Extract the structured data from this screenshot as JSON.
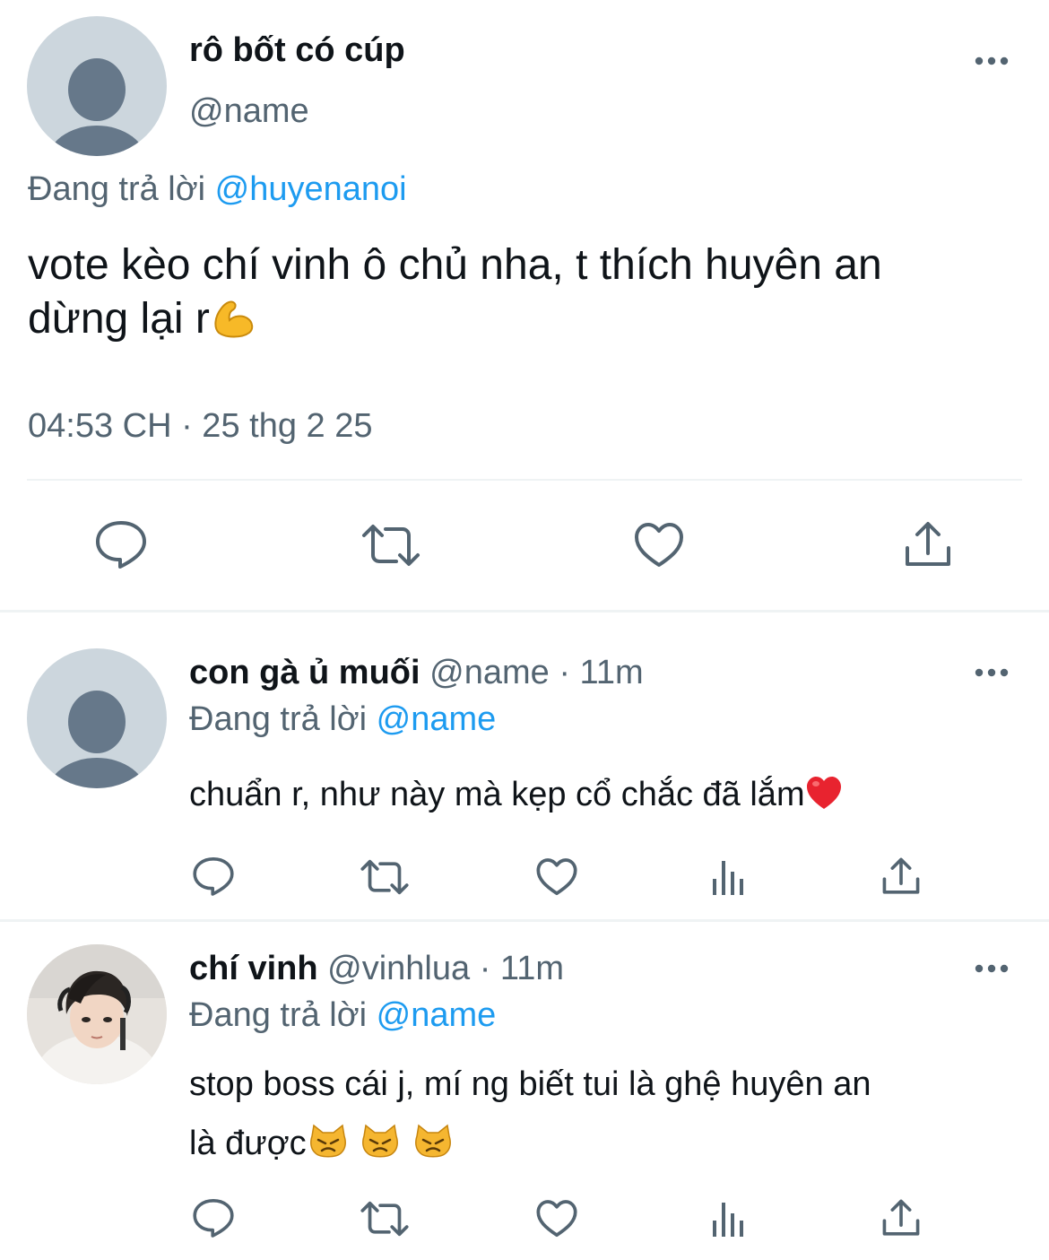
{
  "main_tweet": {
    "display_name": "rô bốt có cúp",
    "handle": "@name",
    "replying_prefix": "Đang trả lời",
    "replying_to": "@huyenanoi",
    "text_line1": "vote kèo chí vinh ô chủ nha, t thích huyên an",
    "text_line2": "dừng lại r",
    "emoji": "flexed-biceps-emoji",
    "timestamp": "04:53 CH · 25 thg 2 25"
  },
  "replies": [
    {
      "display_name": "con gà ủ muối",
      "handle": "@name",
      "time": "· 11m",
      "replying_prefix": "Đang trả lời",
      "replying_to": "@name",
      "text": "chuẩn r, như này mà kẹp cổ chắc đã lắm",
      "emoji": "red-heart-emoji"
    },
    {
      "display_name": "chí vinh",
      "handle": "@vinhlua",
      "time": "· 11m",
      "replying_prefix": "Đang trả lời",
      "replying_to": "@name",
      "text_line1": "stop boss cái j, mí ng biết tui là ghệ huyên an",
      "text_line2": "là được",
      "emoji": "pouting-cat-emoji"
    }
  ],
  "icons": {
    "reply": "speech-bubble-icon",
    "retweet": "retweet-arrows-icon",
    "like": "heart-outline-icon",
    "views": "bar-chart-icon",
    "share": "upload-arrow-icon",
    "more": "three-dots-icon"
  },
  "colors": {
    "text": "#0f1419",
    "secondary": "#536471",
    "link": "#1d9bf0",
    "divider": "#eff3f4",
    "avatar_bg": "#ccd6dd",
    "avatar_fg": "#66788a"
  }
}
